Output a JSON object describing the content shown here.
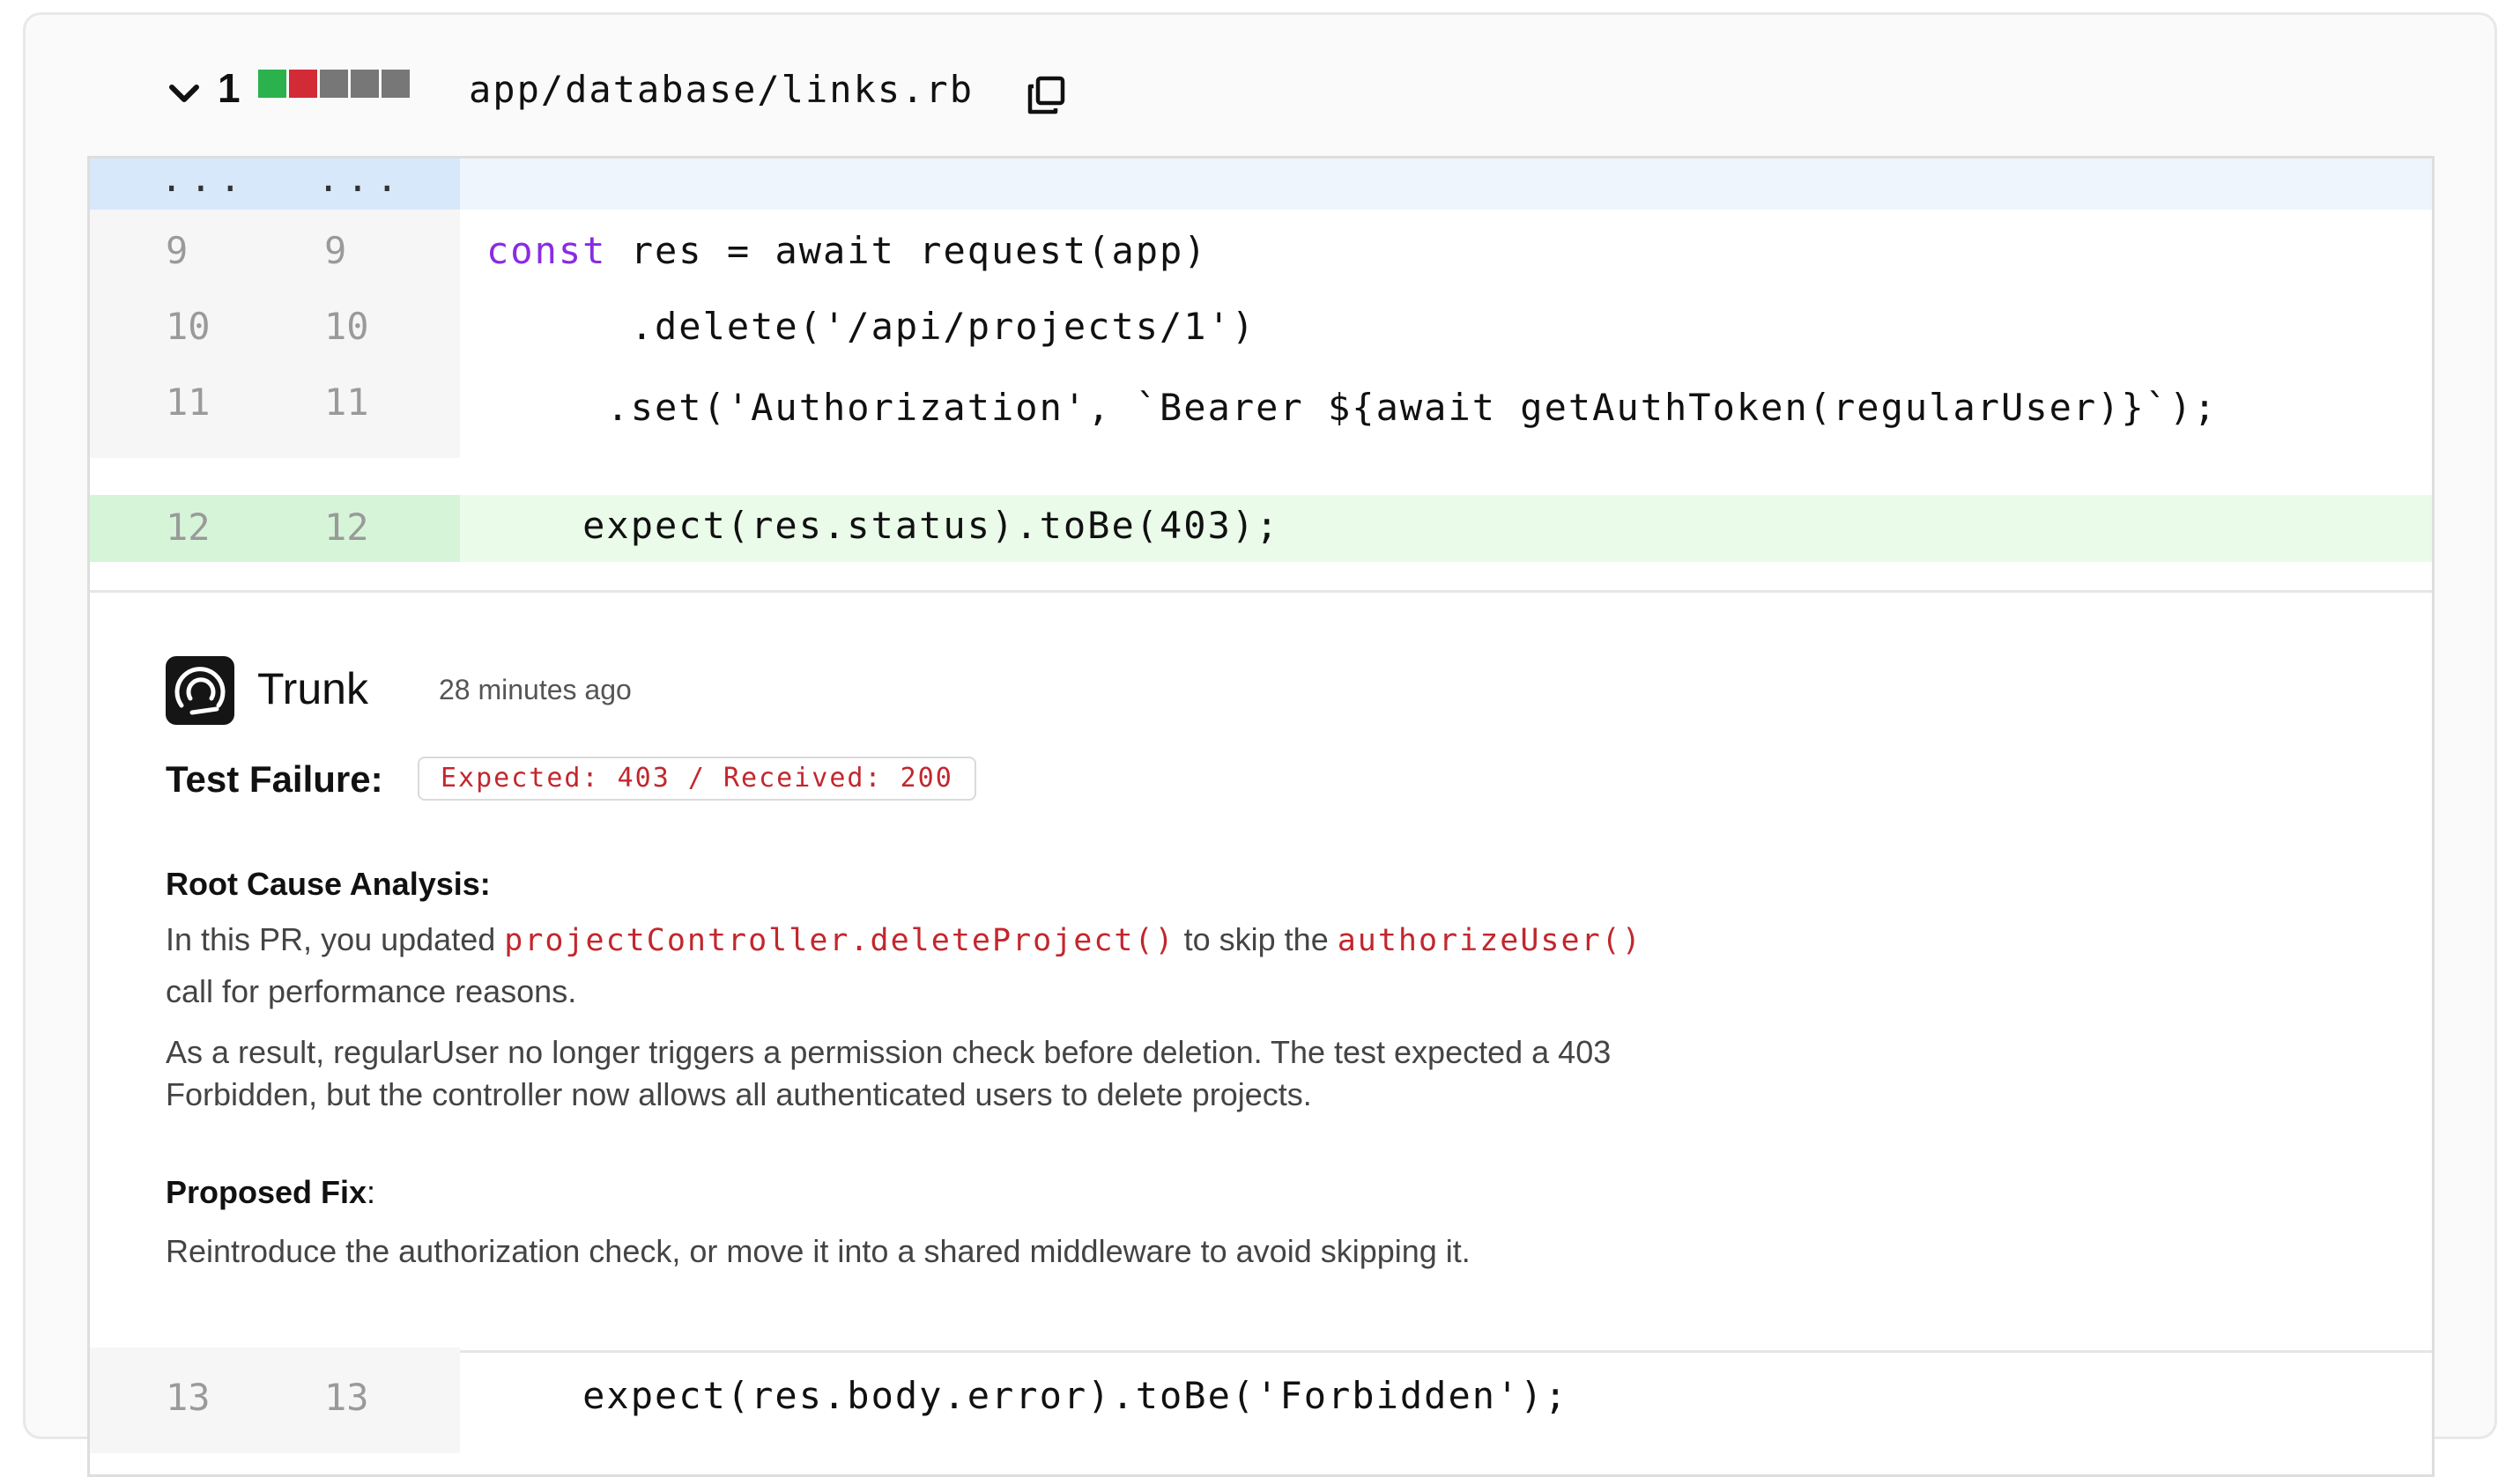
{
  "file": {
    "number": "1",
    "path": "app/database/links.rb",
    "change_squares": [
      "#2bb24c",
      "#d22b36",
      "#777777",
      "#777777",
      "#777777"
    ]
  },
  "diff": {
    "hunk_marker_old": "...",
    "hunk_marker_new": "...",
    "lines": [
      {
        "old": "9",
        "new": "9",
        "keyword": "const",
        "code": " res = await request(app)"
      },
      {
        "old": "10",
        "new": "10",
        "code": "      .delete('/api/projects/1')"
      },
      {
        "old": "11",
        "new": "11",
        "code": "     .set('Authorization', `Bearer ${await getAuthToken(regularUser)}`);"
      },
      {
        "old": "12",
        "new": "12",
        "code": "    expect(res.status).toBe(403);"
      },
      {
        "old": "13",
        "new": "13",
        "code": "    expect(res.body.error).toBe('Forbidden');"
      }
    ]
  },
  "comment": {
    "author": "Trunk",
    "time": "28 minutes ago",
    "test_failure_label": "Test Failure:",
    "test_failure_badge": "Expected: 403 / Received: 200",
    "rca_heading": "Root Cause Analysis:",
    "rca_p1_a": "In this PR, you updated",
    "rca_p1_code1": "projectController.deleteProject()",
    "rca_p1_b": "to skip the",
    "rca_p1_code2": "authorizeUser()",
    "rca_p1_c": "call for performance reasons.",
    "rca_p2": "As a result, regularUser no longer triggers a permission check before deletion. The test expected a 403 Forbidden, but the controller now allows all authenticated users to delete projects.",
    "fix_heading": "Proposed Fix",
    "fix_colon": ":",
    "fix_text": "Reintroduce the authorization check, or move it into a shared middleware to avoid skipping it."
  }
}
